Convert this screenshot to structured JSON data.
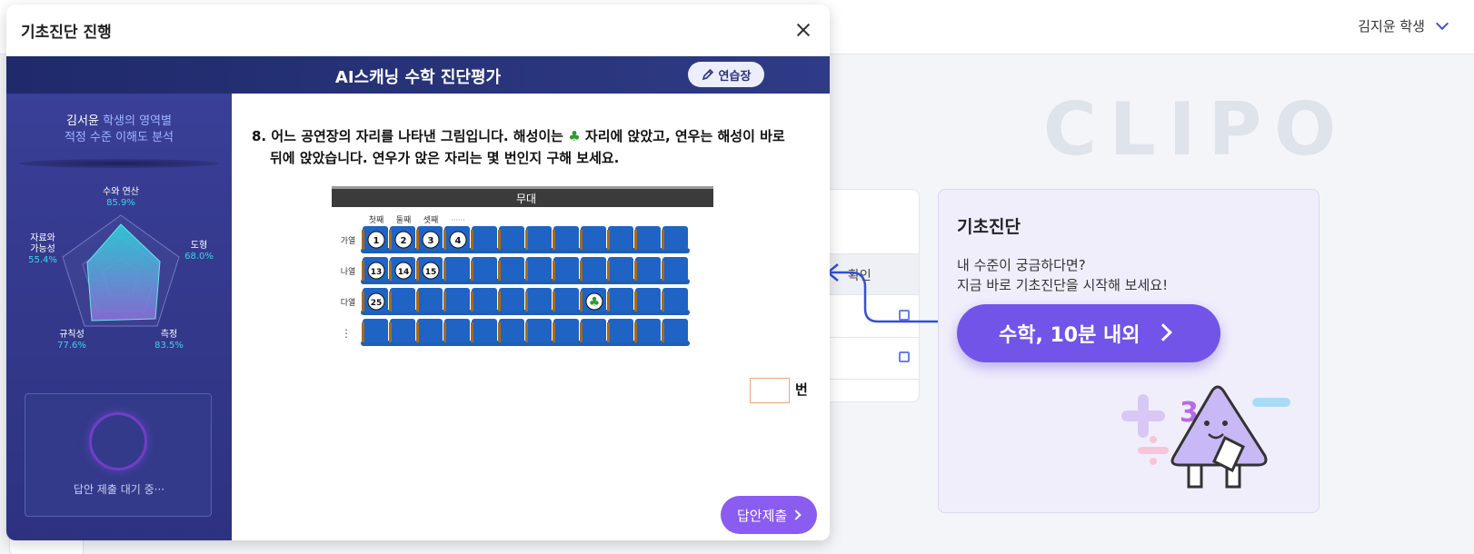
{
  "header": {
    "user_name": "김지윤 학생"
  },
  "background": {
    "watermark": "CLIPO",
    "left_card_partial_label": "확인",
    "diagnosis_card": {
      "title": "기초진단",
      "desc_line1": "내 수준이 궁금하다면?",
      "desc_line2": "지금 바로 기초진단을 시작해 보세요!",
      "start_button": "수학, 10분 내외"
    }
  },
  "modal": {
    "title": "기초진단 진행",
    "exam_title": "AI스캐닝 수학 진단평가",
    "practice_button": "연습장",
    "sidebar": {
      "student_name": "김서윤",
      "heading_part1": "학생의 영역별",
      "heading_part2": "적정 수준 이해도 분석",
      "radar": [
        {
          "label": "수와 연산",
          "value": "85.9%"
        },
        {
          "label": "도형",
          "value": "68.0%"
        },
        {
          "label": "측정",
          "value": "83.5%"
        },
        {
          "label": "규칙성",
          "value": "77.6%"
        },
        {
          "label_line1": "자료와",
          "label_line2": "가능성",
          "value": "55.4%"
        }
      ],
      "status": "답안 제출 대기 중···"
    },
    "question": {
      "number": "8.",
      "line1_a": "어느 공연장의 자리를 나타낸 그림입니다. 해성이는",
      "club_symbol": "♣",
      "line1_b": "자리에 앉았고, 연우는 해성이 바로",
      "line2": "뒤에 앉았습니다. 연우가 앉은 자리는 몇 번인지 구해 보세요."
    },
    "seat_figure": {
      "stage_label": "무대",
      "column_labels": [
        "첫째",
        "둘째",
        "셋째",
        "······"
      ],
      "row_labels": [
        "가열",
        "나열",
        "다열",
        "⋮"
      ],
      "row_ga_numbers": [
        "1",
        "2",
        "3",
        "4"
      ],
      "row_na_numbers": [
        "13",
        "14",
        "15"
      ],
      "row_da_numbers": [
        "25"
      ]
    },
    "answer_unit": "번",
    "submit_button": "답안제출"
  }
}
